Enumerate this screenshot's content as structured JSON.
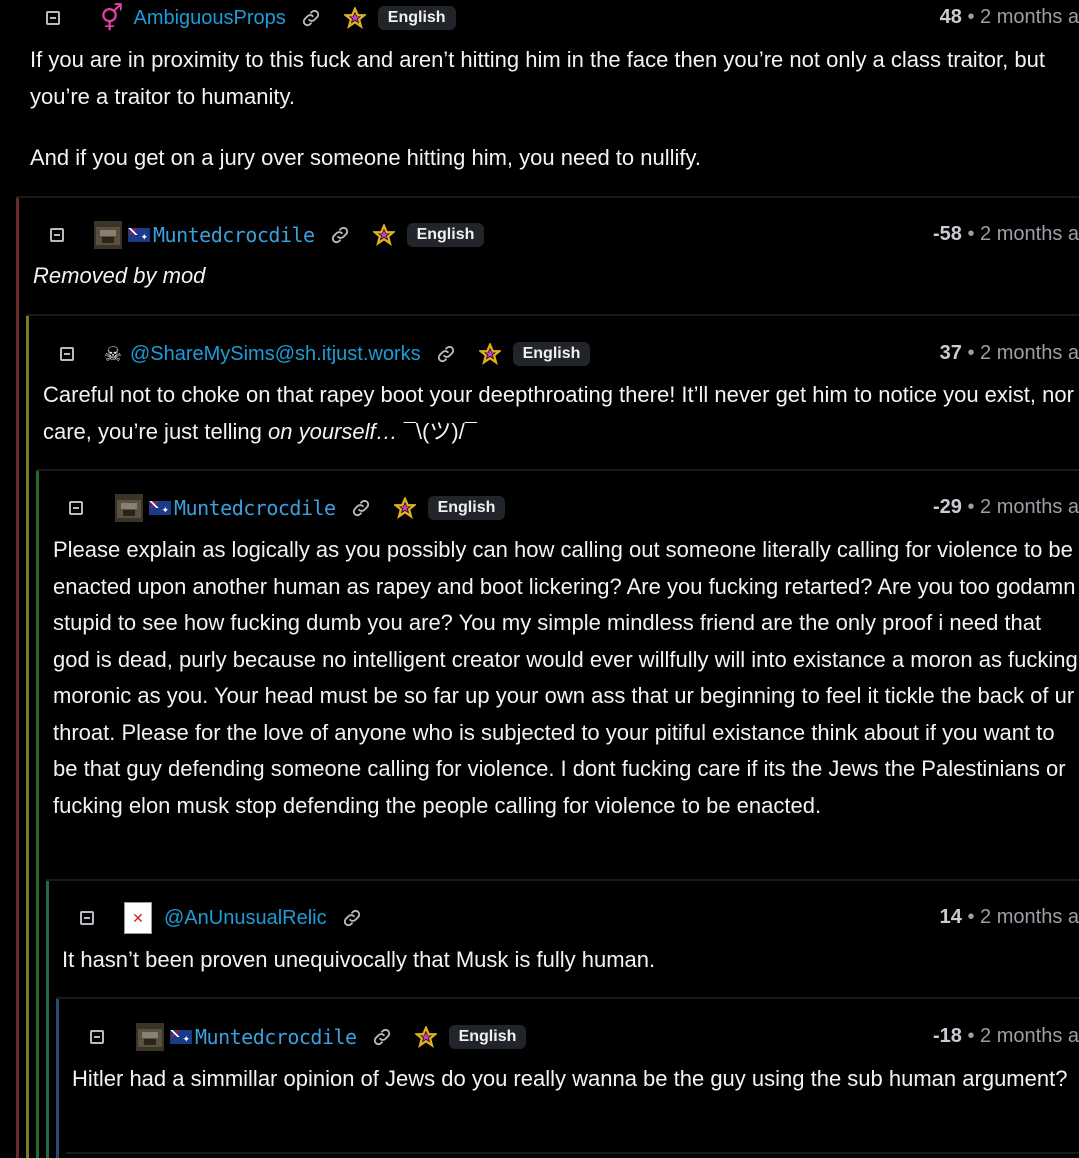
{
  "language_badge": "English",
  "time_ago": "2 months a",
  "comments": [
    {
      "username": "AmbiguousProps",
      "score": "48",
      "paragraphs": [
        "If you are in proximity to this fuck and aren’t hitting him in the face then you’re not only a class traitor, but you’re a traitor to humanity.",
        "And if you get on a jury over someone hitting him, you need to nullify."
      ]
    },
    {
      "username": "Muntedcrocdile",
      "score": "-58",
      "removed_text": "Removed by mod"
    },
    {
      "username": "@ShareMySims@sh.itjust.works",
      "score": "37",
      "body_plain": "Careful not to choke on that rapey boot your deepthroating there! It’ll never get him to notice you exist, nor care, you’re just telling ",
      "body_italic": "on yourself…",
      "body_tail": " ¯\\(ツ)/¯"
    },
    {
      "username": "Muntedcrocdile",
      "score": "-29",
      "body": "Please explain as logically as you possibly can how calling out someone literally calling for violence to be enacted upon another human as rapey and boot lickering? Are you fucking retarted? Are you too godamn stupid to see how fucking dumb you are? You my simple mindless friend are the only proof i need that god is dead, purly because no intelligent creator would ever willfully will into existance a moron as fucking moronic as you. Your head must be so far up your own ass that ur beginning to feel it tickle the back of ur throat. Please for the love of anyone who is subjected to your pitiful existance think about if you want to be that guy defending someone calling for violence. I dont fucking care if its the Jews the Palestinians or fucking elon musk stop defending the people calling for violence to be enacted."
    },
    {
      "username": "@AnUnusualRelic",
      "score": "14",
      "body": "It hasn’t been proven unequivocally that Musk is fully human."
    },
    {
      "username": "Muntedcrocdile",
      "score": "-18",
      "body": "Hitler had a simmillar opinion of Jews do you really wanna be the guy using the sub human argument?"
    }
  ],
  "colors": {
    "background": "#000000",
    "username": "#1e9cd7",
    "thread_level_1": "#6b2a2a",
    "thread_level_2": "#7a7a2a",
    "thread_level_3": "#2a6b2a",
    "thread_level_4": "#1f6b4a",
    "thread_level_5": "#2a4a7a"
  }
}
